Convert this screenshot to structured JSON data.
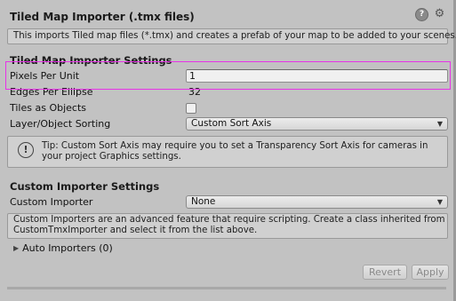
{
  "header": {
    "title": "Tiled Map Importer (.tmx files)",
    "help_icon": "help-icon",
    "settings_icon": "settings-icon",
    "help_glyph": "?",
    "settings_glyph": "⚙"
  },
  "intro": {
    "text": "This imports Tiled map files (*.tmx) and creates a prefab of your map to be added to your scenes."
  },
  "tiled_settings": {
    "title": "Tiled Map Importer Settings",
    "pixels_per_unit": {
      "label": "Pixels Per Unit",
      "value": "1"
    },
    "edges_per_ellipse": {
      "label": "Edges Per Ellipse",
      "value": "32"
    },
    "tiles_as_objects": {
      "label": "Tiles as Objects",
      "checked": false
    },
    "layer_sorting": {
      "label": "Layer/Object Sorting",
      "value": "Custom Sort Axis"
    },
    "tip": {
      "icon": "info-icon",
      "glyph": "!",
      "text": "Tip: Custom Sort Axis may require you to set a Transparency Sort Axis for cameras in your project Graphics settings."
    }
  },
  "custom_importer_settings": {
    "title": "Custom Importer Settings",
    "custom_importer": {
      "label": "Custom Importer",
      "value": "None"
    },
    "info": {
      "text": "Custom Importers are an advanced feature that require scripting. Create a class inherited from CustomTmxImporter and select it from the list above."
    },
    "auto_importers": {
      "label": "Auto Importers (0)",
      "expanded": false
    }
  },
  "buttons": {
    "revert": "Revert",
    "apply": "Apply"
  },
  "colors": {
    "background": "#c2c2c2",
    "highlight": "#e733e7"
  }
}
